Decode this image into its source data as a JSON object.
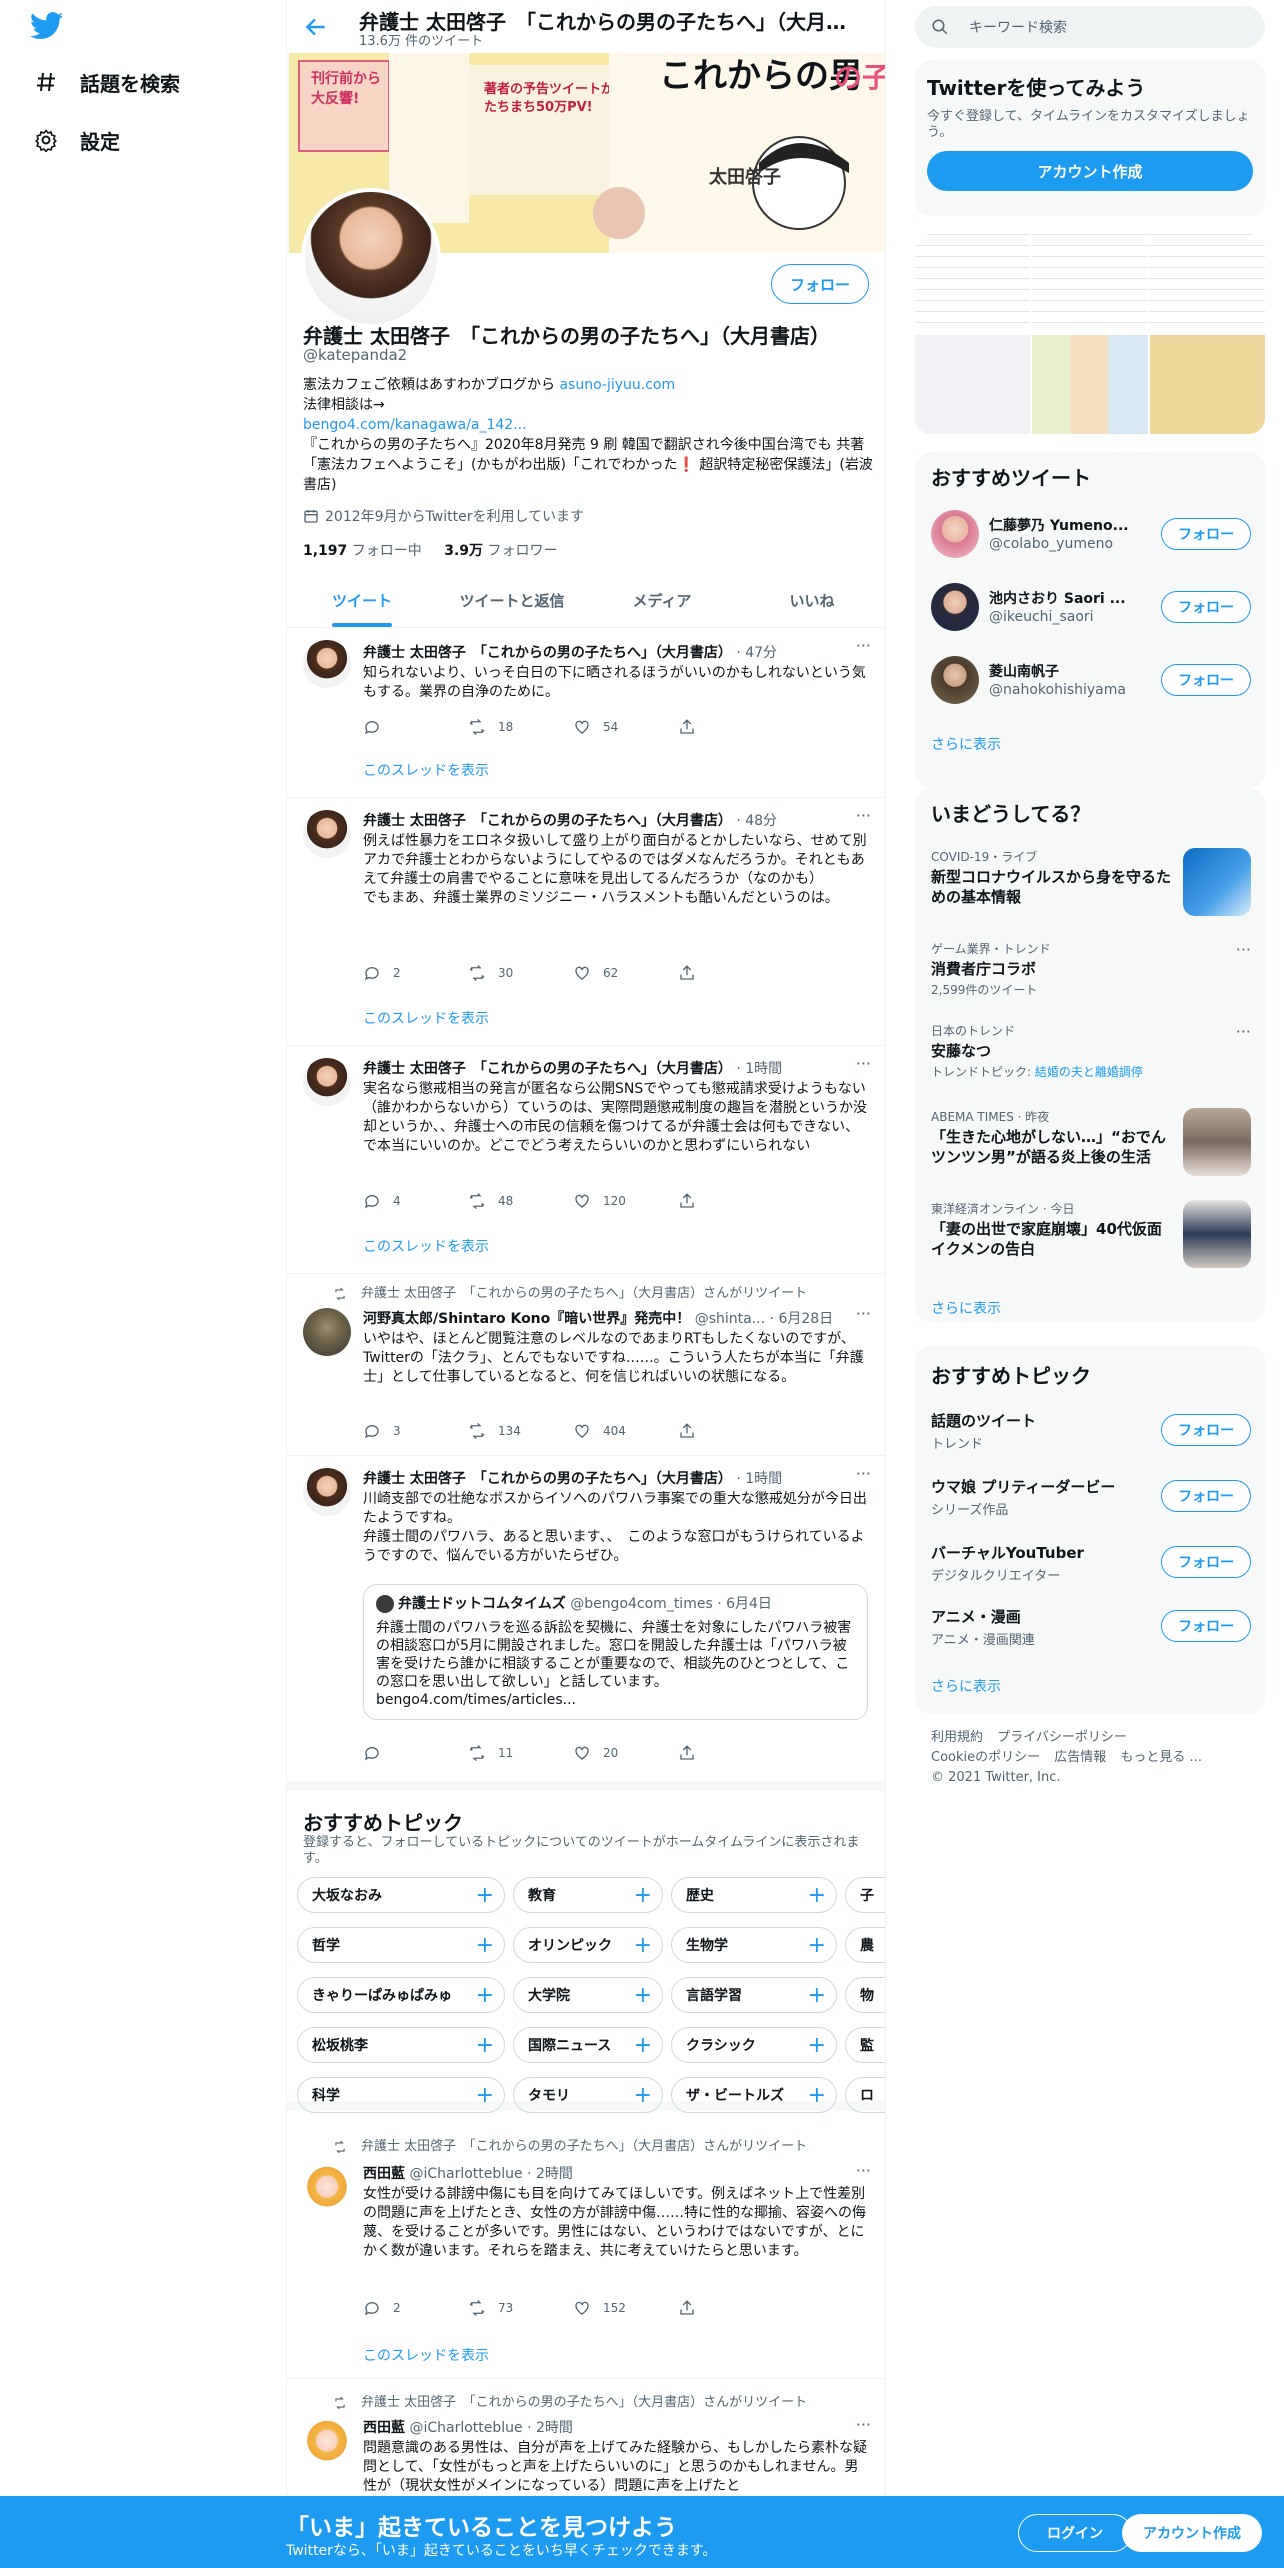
{
  "nav": {
    "explore": "話題を検索",
    "settings": "設定"
  },
  "header": {
    "title": "弁護士 太田啓子　「これからの男の子たちへ」（大月書店）",
    "tweet_count": "13.6万 件のツイート"
  },
  "profile": {
    "follow": "フォロー",
    "name": "弁護士 太田啓子　「これからの男の子たちへ」（大月書店）",
    "handle": "@katepanda2",
    "bio_1": "憲法カフェご依頼はあすわかブログから ",
    "bio_link1": "asuno-jiyuu.com",
    "bio_2": "法律相談は→",
    "bio_link2": "bengo4.com/kanagawa/a_142...",
    "bio_3": "『これからの男の子たちへ』2020年8月発売  9 刷 韓国で翻訳され今後中国台湾でも 共著「憲法カフェへようこそ」(かもがわ出版)「これでわかった❗ 超訳特定秘密保護法」(岩波書店)",
    "joined": "2012年9月からTwitterを利用しています",
    "following_count": "1,197",
    "following_label": " フォロー中",
    "followers_count": "3.9万",
    "followers_label": " フォロワー"
  },
  "tabs": [
    "ツイート",
    "ツイートと返信",
    "メディア",
    "いいね"
  ],
  "tweets": [
    {
      "author": "弁護士 太田啓子　「これからの男の子たちへ」（大月書店）",
      "handle": "@katepanda2",
      "time": "47分",
      "text": "知られないより、いっそ白日の下に晒されるほうがいいのかもしれないという気もする。業界の自浄のために。",
      "replies": "",
      "retweets": "18",
      "likes": "54",
      "thread": "このスレッドを表示"
    },
    {
      "author": "弁護士 太田啓子　「これからの男の子たちへ」（大月書店）",
      "handle": "@katepanda2",
      "time": "48分",
      "text": "例えば性暴力をエロネタ扱いして盛り上がり面白がるとかしたいなら、せめて別アカで弁護士とわからないようにしてやるのではダメなんだろうか。それともあえて弁護士の肩書でやることに意味を見出してるんだろうか（なのかも）\nでもまあ、弁護士業界のミソジニー・ハラスメントも酷いんだというのは。",
      "replies": "2",
      "retweets": "30",
      "likes": "62",
      "thread": "このスレッドを表示"
    },
    {
      "author": "弁護士 太田啓子　「これからの男の子たちへ」（大月書店）",
      "handle": "@katepanda2",
      "time": "1時間",
      "text": "実名なら懲戒相当の発言が匿名なら公開SNSでやっても懲戒請求受けようもない（誰かわからないから）ていうのは、実際問題懲戒制度の趣旨を潜脱というか没却というか、、弁護士への市民の信頼を傷つけてるが弁護士会は何もできない、で本当にいいのか。どこでどう考えたらいいのかと思わずにいられない",
      "replies": "4",
      "retweets": "48",
      "likes": "120",
      "thread": "このスレッドを表示"
    },
    {
      "retweeted_by": "弁護士 太田啓子　「これからの男の子たちへ」（大月書店）さんがリツイート",
      "author": "河野真太郎/Shintaro Kono『暗い世界』発売中！",
      "handle": "@shinta...",
      "time": "6月28日",
      "text": "いやはや、ほとんど閲覧注意のレベルなのであまりRTもしたくないのですが、Twitterの「法クラ」、とんでもないですね……。こういう人たちが本当に「弁護士」として仕事しているとなると、何を信じればいいの状態になる。",
      "replies": "3",
      "retweets": "134",
      "likes": "404"
    },
    {
      "author": "弁護士 太田啓子　「これからの男の子たちへ」（大月書店）",
      "handle": "@katepanda2",
      "time": "1時間",
      "text": "川崎支部での壮絶なボスからイソへのパワハラ事案での重大な懲戒処分が今日出たようですね。\n弁護士間のパワハラ、あると思います、、　このような窓口がもうけられているようですので、悩んでいる方がいたらぜひ。",
      "quote_author": "弁護士ドットコムタイムズ",
      "quote_handle": "@bengo4com_times · 6月4日",
      "quote_text": "弁護士間のパワハラを巡る訴訟を契機に、弁護士を対象にしたパワハラ被害の相談窓口が5月に開設されました。窓口を開設した弁護士は「パワハラ被害を受けたら誰かに相談することが重要なので、相談先のひとつとして、この窓口を思い出して欲しい」と話しています。",
      "quote_link": "bengo4.com/times/articles...",
      "replies": "",
      "retweets": "11",
      "likes": "20"
    },
    {
      "retweeted_by": "弁護士 太田啓子　「これからの男の子たちへ」（大月書店）さんがリツイート",
      "author": "西田藍",
      "handle": "@iCharlotteblue",
      "time": "2時間",
      "text": "女性が受ける誹謗中傷にも目を向けてみてほしいです。例えばネット上で性差別の問題に声を上げたとき、女性の方が誹謗中傷……特に性的な揶揄、容姿への侮蔑、を受けることが多いです。男性にはない、というわけではないですが、とにかく数が違います。それらを踏まえ、共に考えていけたらと思います。",
      "replies": "2",
      "retweets": "73",
      "likes": "152",
      "thread": "このスレッドを表示"
    },
    {
      "retweeted_by": "弁護士 太田啓子　「これからの男の子たちへ」（大月書店）さんがリツイート",
      "author": "西田藍",
      "handle": "@iCharlotteblue",
      "time": "2時間",
      "text": "問題意識のある男性は、自分が声を上げてみた経験から、もしかしたら素朴な疑問として、「女性がもっと声を上げたらいいのに」と思うのかもしれません。男性が（現状女性がメインになっている）問題に声を上げたと"
    }
  ],
  "topics": {
    "title": "おすすめトピック",
    "subtitle": "登録すると、フォローしているトピックについてのツイートがホームタイムラインに表示されます。",
    "rows": [
      [
        "大坂なおみ",
        "教育",
        "歴史",
        "子"
      ],
      [
        "哲学",
        "オリンピック",
        "生物学",
        "農"
      ],
      [
        "きゃりーぱみゅぱみゅ",
        "大学院",
        "言語学習",
        "物"
      ],
      [
        "松坂桃李",
        "国際ニュース",
        "クラシック",
        "監"
      ],
      [
        "科学",
        "タモリ",
        "ザ・ビートルズ",
        "ロ"
      ]
    ]
  },
  "right": {
    "search_placeholder": "キーワード検索",
    "signup_title": "Twitterを使ってみよう",
    "signup_text": "今すぐ登録して、タイムラインをカスタマイズしましょう。",
    "signup_button": "アカウント作成",
    "rec_title": "おすすめツイート",
    "rec_users": [
      {
        "name": "仁藤夢乃 Yumeno...",
        "handle": "@colabo_yumeno",
        "follow": "フォロー"
      },
      {
        "name": "池内さおり Saori ...",
        "handle": "@ikeuchi_saori",
        "follow": "フォロー"
      },
      {
        "name": "菱山南帆子",
        "handle": "@nahokohishiyama",
        "follow": "フォロー"
      }
    ],
    "show_more": "さらに表示",
    "trend_title": "いまどうしてる？",
    "trends": [
      {
        "meta": "COVID-19・ライブ",
        "title": "新型コロナウイルスから身を守るための基本情報",
        "sub": ""
      },
      {
        "meta": "ゲーム業界・トレンド",
        "title": "消費者庁コラボ",
        "sub": "2,599件のツイート"
      },
      {
        "meta": "日本のトレンド",
        "title": "安藤なつ",
        "sub": "トレンドトピック: ",
        "sub_link": "結婚の夫と離婚調停"
      },
      {
        "meta": "ABEMA TIMES · 昨夜",
        "title": "「生きた心地がしない…」“おでんツンツン男”が語る炎上後の生活",
        "sub": ""
      },
      {
        "meta": "東洋経済オンライン · 今日",
        "title": "「妻の出世で家庭崩壊」40代仮面イクメンの告白",
        "sub": ""
      }
    ],
    "topic_title": "おすすめトピック",
    "topics": [
      {
        "name": "話題のツイート",
        "cat": "トレンド",
        "follow": "フォロー"
      },
      {
        "name": "ウマ娘 プリティーダービー",
        "cat": "シリーズ作品",
        "follow": "フォロー"
      },
      {
        "name": "バーチャルYouTuber",
        "cat": "デジタルクリエイター",
        "follow": "フォロー"
      },
      {
        "name": "アニメ・漫画",
        "cat": "アニメ・漫画関連",
        "follow": "フォロー"
      }
    ],
    "footer": [
      "利用規約",
      "プライバシーポリシー",
      "Cookieのポリシー",
      "広告情報",
      "もっと見る ...",
      "© 2021 Twitter, Inc."
    ]
  },
  "bottom": {
    "headline": "「いま」起きていることを見つけよう",
    "sub": "Twitterなら、「いま」起きていることをいち早くチェックできます。",
    "login": "ログイン",
    "signup": "アカウント作成"
  }
}
